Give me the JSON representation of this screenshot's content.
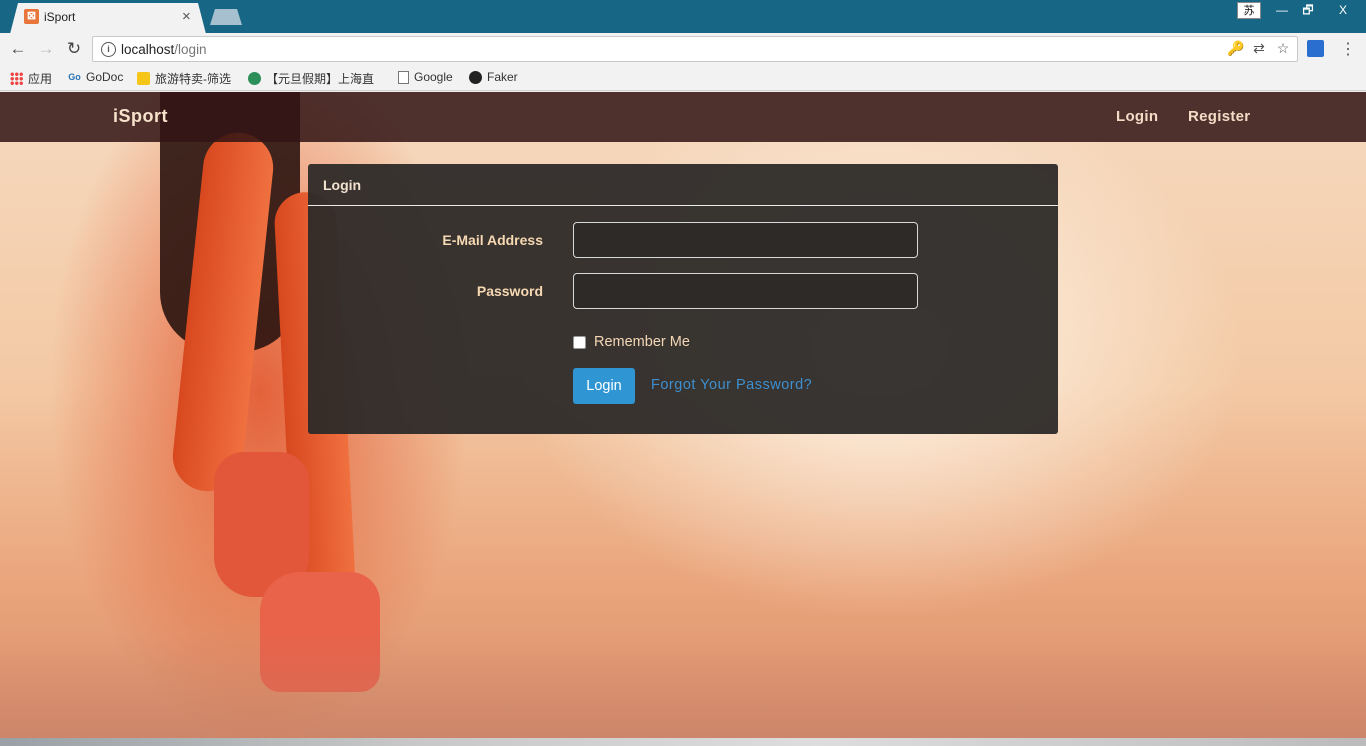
{
  "browser": {
    "tab_title": "iSport",
    "tab_close": "×",
    "url_host": "localhost",
    "url_path": "/login",
    "ime_indicator": "苏",
    "window_controls": {
      "minimize": "—",
      "maximize": "🗗",
      "close": "X"
    },
    "nav": {
      "back": "←",
      "forward": "→",
      "reload": "↻"
    },
    "omnibox_icons": {
      "key": "🔑",
      "translate": "⇄",
      "star": "☆"
    },
    "menu": "⋮",
    "bookmarks": [
      {
        "label": "应用",
        "icon": "apps-icon"
      },
      {
        "label": "GoDoc",
        "icon": "godoc-icon"
      },
      {
        "label": "旅游特卖-筛选",
        "icon": "travel-icon"
      },
      {
        "label": "【元旦假期】上海直",
        "icon": "q-icon"
      },
      {
        "label": "Google",
        "icon": "page-icon"
      },
      {
        "label": "Faker",
        "icon": "github-icon"
      }
    ]
  },
  "navbar": {
    "brand": "iSport",
    "links": {
      "login": "Login",
      "register": "Register"
    }
  },
  "login_panel": {
    "heading": "Login",
    "email_label": "E-Mail Address",
    "email_value": "",
    "password_label": "Password",
    "password_value": "",
    "remember_label": "Remember Me",
    "remember_checked": false,
    "submit_label": "Login",
    "forgot_label": "Forgot Your Password?"
  },
  "colors": {
    "titlebar": "#176685",
    "navbar": "#321414",
    "panel": "#2d2a28",
    "button": "#2f96d3",
    "link": "#3d8fcf",
    "label": "#f6d8b3"
  }
}
